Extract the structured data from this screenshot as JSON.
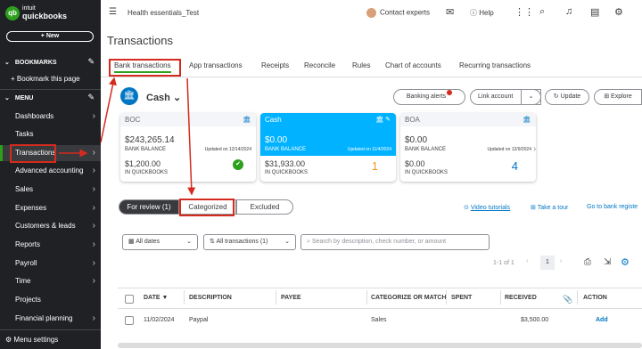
{
  "logo": {
    "brand": "intuit",
    "product": "quickbooks"
  },
  "sidebar": {
    "new_label": "+ New",
    "bookmarks": "BOOKMARKS",
    "bookmark_page": "+ Bookmark this page",
    "menu": "MENU",
    "items": [
      {
        "label": "Dashboards"
      },
      {
        "label": "Tasks"
      },
      {
        "label": "Transactions"
      },
      {
        "label": "Advanced accounting"
      },
      {
        "label": "Sales"
      },
      {
        "label": "Expenses"
      },
      {
        "label": "Customers & leads"
      },
      {
        "label": "Reports"
      },
      {
        "label": "Payroll"
      },
      {
        "label": "Time"
      },
      {
        "label": "Projects"
      },
      {
        "label": "Financial planning"
      }
    ],
    "menu_settings": "Menu settings"
  },
  "topbar": {
    "company": "Health essentials_Test",
    "contact": "Contact experts",
    "help": "Help"
  },
  "page_title": "Transactions",
  "tabs": [
    "Bank transactions",
    "App transactions",
    "Receipts",
    "Reconcile",
    "Rules",
    "Chart of accounts",
    "Recurring transactions"
  ],
  "account": {
    "name": "Cash",
    "bank_alerts": "Banking alerts",
    "link_account": "Link account",
    "update": "Update",
    "explore": "Explore"
  },
  "cards": [
    {
      "name": "BOC",
      "bank_balance": "$243,265.14",
      "bank_label": "BANK BALANCE",
      "updated": "Updated on 12/14/2024",
      "qb_balance": "$1,200.00",
      "qb_label": "IN QUICKBOOKS",
      "count": "✔"
    },
    {
      "name": "Cash",
      "bank_balance": "$0.00",
      "bank_label": "BANK BALANCE",
      "updated": "Updated on 11/4/2024",
      "qb_balance": "$31,933.00",
      "qb_label": "IN QUICKBOOKS",
      "count": "1"
    },
    {
      "name": "BOA",
      "bank_balance": "$0.00",
      "bank_label": "BANK BALANCE",
      "updated": "Updated on 12/9/2024",
      "qb_balance": "$0.00",
      "qb_label": "IN QUICKBOOKS",
      "count": "4"
    }
  ],
  "segments": {
    "review": "For review (1)",
    "categorized": "Categorized",
    "excluded": "Excluded"
  },
  "links": {
    "video": "Video tutorials",
    "tour": "Take a tour",
    "register": "Go to bank registe"
  },
  "filters": {
    "dates": "All dates",
    "transactions": "All transactions (1)",
    "search_placeholder": "Search by description, check number, or amount"
  },
  "pager": {
    "range": "1-1 of 1",
    "page": "1"
  },
  "table": {
    "headers": [
      "DATE ▼",
      "DESCRIPTION",
      "PAYEE",
      "CATEGORIZE OR MATCH",
      "SPENT",
      "RECEIVED",
      "ACTION"
    ],
    "rows": [
      {
        "date": "11/02/2024",
        "description": "Paypal",
        "payee": "",
        "category": "Sales",
        "spent": "",
        "received": "$3,500.00",
        "action": "Add"
      }
    ]
  },
  "colors": {
    "brand_green": "#2ca01c",
    "sidebar_bg": "#1f2124",
    "selected_card": "#00b2ff",
    "link_blue": "#0077c5",
    "annotation_red": "#d52b1e"
  }
}
